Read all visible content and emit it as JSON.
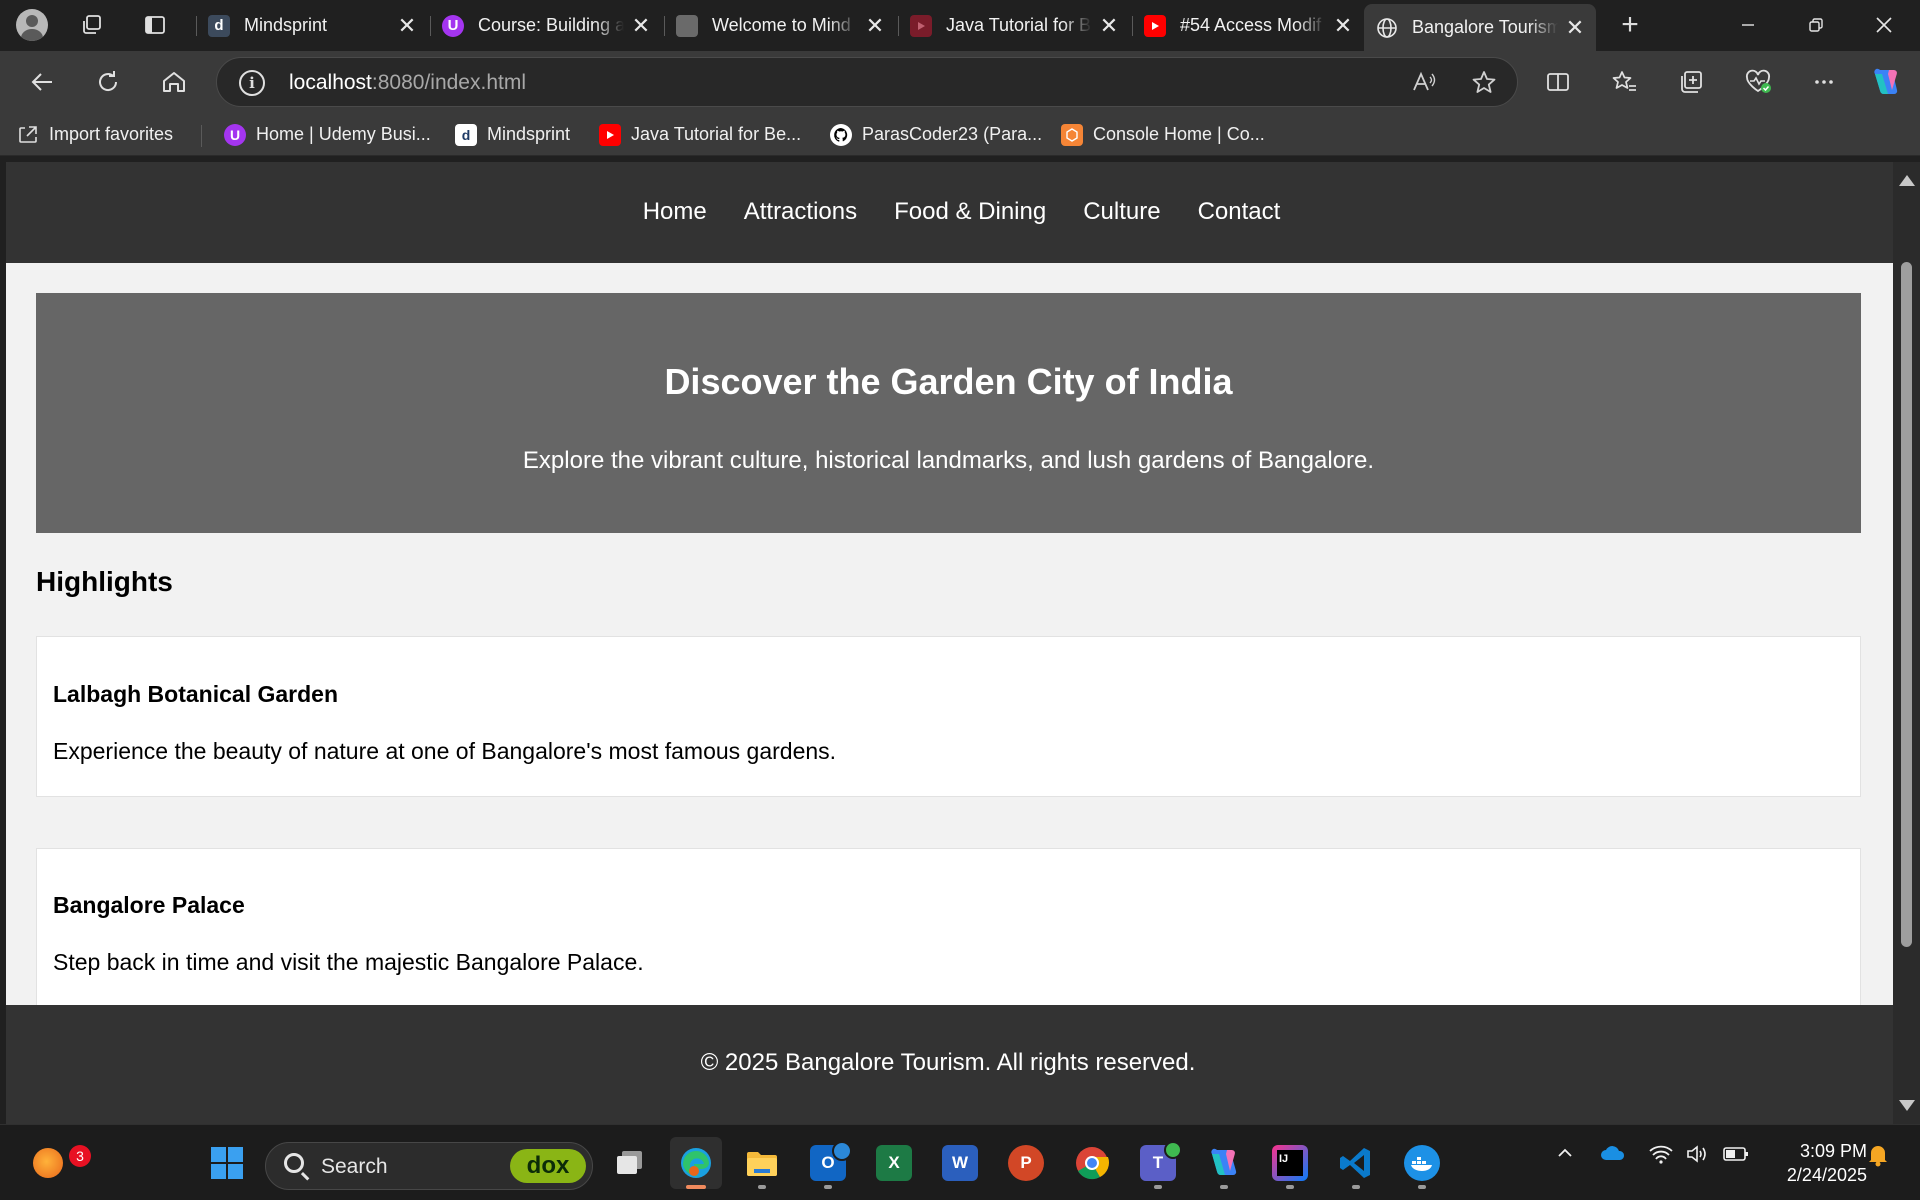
{
  "browser": {
    "tabs": [
      {
        "title": "Mindsprint",
        "favicon_text": "d",
        "favicon_color": "#3c4a5c"
      },
      {
        "title": "Course: Building a",
        "favicon_text": "U",
        "favicon_color": "#a435f0"
      },
      {
        "title": "Welcome to Mind",
        "favicon_text": "",
        "favicon_color": "#6a6a6a"
      },
      {
        "title": "Java Tutorial for B",
        "favicon_text": "",
        "favicon_color": "#7a1c2a"
      },
      {
        "title": "#54 Access Modif",
        "favicon_text": "",
        "favicon_color": "#ff0000"
      },
      {
        "title": "Bangalore Tourism",
        "favicon_text": "",
        "favicon_color": "#3a3a3a"
      }
    ],
    "active_tab_index": 5,
    "address": {
      "host": "localhost",
      "rest": ":8080/index.html"
    },
    "favorites": [
      {
        "label": "Import favorites",
        "icon": "import-icon",
        "color": "#3a3a3a"
      },
      {
        "label": "Home | Udemy Busi...",
        "icon": "udemy-icon",
        "color": "#a435f0"
      },
      {
        "label": "Mindsprint",
        "icon": "mindsprint-icon",
        "color": "#ffffff"
      },
      {
        "label": "Java Tutorial for Be...",
        "icon": "youtube-icon",
        "color": "#ff0000"
      },
      {
        "label": "ParasCoder23 (Para...",
        "icon": "github-icon",
        "color": "#ffffff"
      },
      {
        "label": "Console Home | Co...",
        "icon": "aws-icon",
        "color": "#f58536"
      }
    ]
  },
  "site": {
    "nav": [
      "Home",
      "Attractions",
      "Food & Dining",
      "Culture",
      "Contact"
    ],
    "hero": {
      "title": "Discover the Garden City of India",
      "subtitle": "Explore the vibrant culture, historical landmarks, and lush gardens of Bangalore."
    },
    "highlights": {
      "title": "Highlights",
      "cards": [
        {
          "title": "Lalbagh Botanical Garden",
          "text": "Experience the beauty of nature at one of Bangalore's most famous gardens."
        },
        {
          "title": "Bangalore Palace",
          "text": "Step back in time and visit the majestic Bangalore Palace."
        }
      ]
    },
    "footer": "© 2025 Bangalore Tourism. All rights reserved."
  },
  "taskbar": {
    "search_placeholder": "Search",
    "search_badge": "dox",
    "widget_badge": "3",
    "time": "3:09 PM",
    "date": "2/24/2025"
  }
}
